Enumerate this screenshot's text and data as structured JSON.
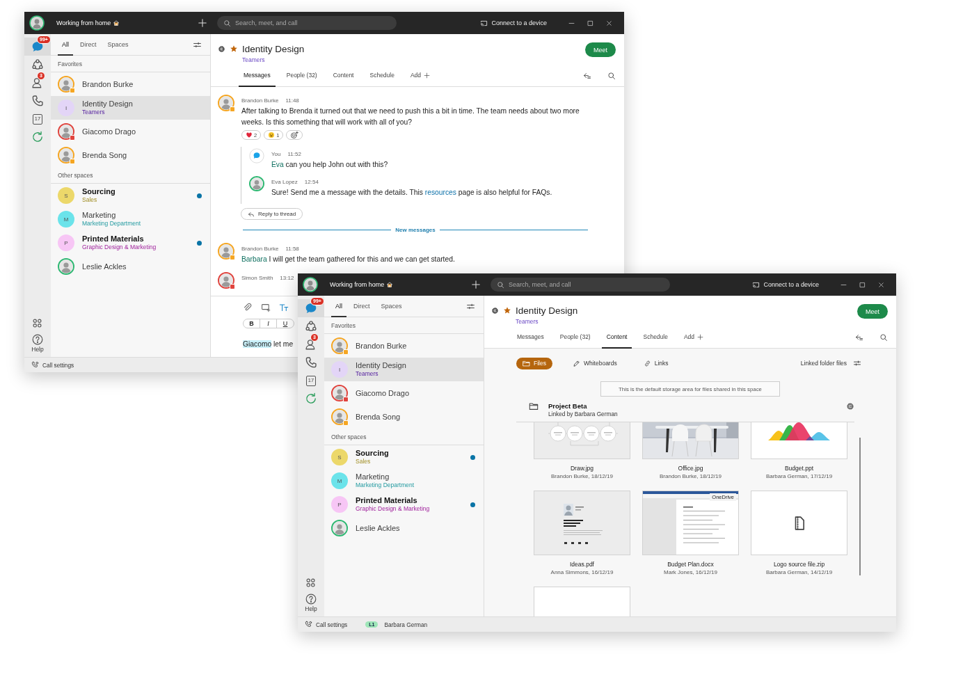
{
  "windows": [
    {
      "kind": "messages",
      "title_bar": {
        "status": "Working from home",
        "search_placeholder": "Search, meet, and call",
        "connect": "Connect to a device"
      },
      "rail": {
        "items": [
          {
            "kind": "chat",
            "badge": "99+",
            "selected": true
          },
          {
            "kind": "teams",
            "selected": false
          },
          {
            "kind": "contacts",
            "badge": "3",
            "selected": false
          },
          {
            "kind": "calls",
            "selected": false
          },
          {
            "kind": "calendar",
            "label": "17",
            "selected": false
          },
          {
            "kind": "refresh",
            "selected": false
          }
        ],
        "help": "Help"
      },
      "sidebar": {
        "filters": [
          {
            "label": "All",
            "selected": true
          },
          {
            "label": "Direct",
            "selected": false
          },
          {
            "label": "Spaces",
            "selected": false
          }
        ],
        "sections": [
          {
            "title": "Favorites",
            "items": [
              {
                "kind": "person",
                "name": "Brandon Burke",
                "color": "#f5a623",
                "presence": true,
                "selected": false,
                "unread": false
              },
              {
                "kind": "space",
                "initial": "I",
                "name": "Identity Design",
                "subtitle": "Teamers",
                "color": "#e3d5f7",
                "selected": true,
                "unread": false
              },
              {
                "kind": "person",
                "name": "Giacomo Drago",
                "color": "#e0443e",
                "presence": true,
                "selected": false,
                "unread": false
              },
              {
                "kind": "person",
                "name": "Brenda Song",
                "color": "#f5a623",
                "presence": true,
                "selected": false,
                "unread": false
              }
            ]
          },
          {
            "title": "Other spaces",
            "items": [
              {
                "kind": "space",
                "initial": "S",
                "name": "Sourcing",
                "subtitle": "Sales",
                "color": "#ecd86a",
                "selected": false,
                "unread": true
              },
              {
                "kind": "space",
                "initial": "M",
                "name": "Marketing",
                "subtitle": "Marketing Department",
                "color": "#6be3ea",
                "selected": false,
                "unread": false
              },
              {
                "kind": "space",
                "initial": "P",
                "name": "Printed Materials",
                "subtitle": "Graphic Design & Marketing",
                "color": "#f7c6f5",
                "selected": false,
                "unread": true
              },
              {
                "kind": "person",
                "name": "Leslie Ackles",
                "color": "#2eb872",
                "presence": false,
                "selected": false,
                "unread": false
              }
            ]
          }
        ]
      },
      "space": {
        "name": "Identity Design",
        "team": "Teamers",
        "favorite": true,
        "meet": "Meet",
        "tabs": [
          {
            "label": "Messages",
            "selected": true
          },
          {
            "label": "People (32)",
            "selected": false
          },
          {
            "label": "Content",
            "selected": false
          },
          {
            "label": "Schedule",
            "selected": false
          },
          {
            "label": "Add",
            "selected": false
          }
        ]
      },
      "messages": [
        {
          "kind": "message",
          "author": "Brandon Burke",
          "time": "11:48",
          "avatar": {
            "kind": "person",
            "color": "#f5a623",
            "presence": true
          },
          "parts": [
            {
              "text": "After talking to Brenda it turned out that we need to push this a bit in time. The team needs about two more weeks. Is this something that will work with all of you?"
            }
          ],
          "reactions": [
            {
              "kind": "heart",
              "count": "2"
            },
            {
              "kind": "smile",
              "count": "1"
            },
            {
              "kind": "add"
            }
          ],
          "thread": {
            "replies": [
              {
                "author": "You",
                "time": "11:52",
                "avatar": {
                  "kind": "self",
                  "color": "#1aa3e8"
                },
                "parts": [
                  {
                    "kind": "mention",
                    "text": "Eva"
                  },
                  {
                    "text": " can you help John out with this?"
                  }
                ]
              },
              {
                "author": "Eva Lopez",
                "time": "12:54",
                "avatar": {
                  "kind": "person",
                  "color": "#2eb872",
                  "presence": false
                },
                "parts": [
                  {
                    "text": "Sure! Send me a message with the details. This "
                  },
                  {
                    "kind": "link",
                    "text": "resources"
                  },
                  {
                    "text": " page is also helpful for FAQs."
                  }
                ]
              }
            ],
            "reply_button": "Reply to thread"
          }
        },
        {
          "kind": "divider",
          "label": "New messages"
        },
        {
          "kind": "message",
          "author": "Brandon Burke",
          "time": "11:58",
          "avatar": {
            "kind": "person",
            "color": "#f5a623",
            "presence": true
          },
          "parts": [
            {
              "kind": "mention",
              "text": "Barbara"
            },
            {
              "text": " I will get the team gathered for this and we can get started."
            }
          ]
        },
        {
          "kind": "message",
          "author": "Simon Smith",
          "time": "13:12",
          "avatar": {
            "kind": "person",
            "color": "#e0443e",
            "presence": true
          }
        }
      ],
      "composer": {
        "tools": [
          {
            "kind": "attach",
            "active": false
          },
          {
            "kind": "screen",
            "active": false
          },
          {
            "kind": "format",
            "active": true
          }
        ],
        "format_buttons": [
          {
            "kind": "bold",
            "label": "B"
          },
          {
            "kind": "italic",
            "label": "I"
          },
          {
            "kind": "underline",
            "label": "U"
          }
        ],
        "parts": [
          {
            "kind": "mention",
            "text": "Giacomo"
          },
          {
            "text": " let me"
          }
        ]
      },
      "status_bar": {
        "call_settings": "Call settings"
      }
    },
    {
      "kind": "content",
      "title_bar": {
        "status": "Working from home",
        "search_placeholder": "Search, meet, and call",
        "connect": "Connect to a device"
      },
      "rail": {
        "items": [
          {
            "kind": "chat",
            "badge": "99+",
            "selected": true
          },
          {
            "kind": "teams",
            "selected": false
          },
          {
            "kind": "contacts",
            "badge": "3",
            "selected": false
          },
          {
            "kind": "calls",
            "selected": false
          },
          {
            "kind": "calendar",
            "label": "17",
            "selected": false
          },
          {
            "kind": "refresh",
            "selected": false
          }
        ],
        "help": "Help"
      },
      "sidebar": {
        "filters": [
          {
            "label": "All",
            "selected": true
          },
          {
            "label": "Direct",
            "selected": false
          },
          {
            "label": "Spaces",
            "selected": false
          }
        ],
        "sections": [
          {
            "title": "Favorites",
            "items": [
              {
                "kind": "person",
                "name": "Brandon Burke",
                "color": "#f5a623",
                "presence": true,
                "selected": false,
                "unread": false
              },
              {
                "kind": "space",
                "initial": "I",
                "name": "Identity Design",
                "subtitle": "Teamers",
                "color": "#e3d5f7",
                "selected": true,
                "unread": false
              },
              {
                "kind": "person",
                "name": "Giacomo Drago",
                "color": "#e0443e",
                "presence": true,
                "selected": false,
                "unread": false
              },
              {
                "kind": "person",
                "name": "Brenda Song",
                "color": "#f5a623",
                "presence": true,
                "selected": false,
                "unread": false
              }
            ]
          },
          {
            "title": "Other spaces",
            "items": [
              {
                "kind": "space",
                "initial": "S",
                "name": "Sourcing",
                "subtitle": "Sales",
                "color": "#ecd86a",
                "selected": false,
                "unread": true
              },
              {
                "kind": "space",
                "initial": "M",
                "name": "Marketing",
                "subtitle": "Marketing Department",
                "color": "#6be3ea",
                "selected": false,
                "unread": false
              },
              {
                "kind": "space",
                "initial": "P",
                "name": "Printed Materials",
                "subtitle": "Graphic Design & Marketing",
                "color": "#f7c6f5",
                "selected": false,
                "unread": true
              },
              {
                "kind": "person",
                "name": "Leslie Ackles",
                "color": "#2eb872",
                "presence": false,
                "selected": false,
                "unread": false
              }
            ]
          }
        ]
      },
      "space": {
        "name": "Identity Design",
        "team": "Teamers",
        "favorite": true,
        "meet": "Meet",
        "tabs": [
          {
            "label": "Messages",
            "selected": false
          },
          {
            "label": "People (32)",
            "selected": false
          },
          {
            "label": "Content",
            "selected": true
          },
          {
            "label": "Schedule",
            "selected": false
          },
          {
            "label": "Add",
            "selected": false
          }
        ]
      },
      "content": {
        "filters": [
          {
            "kind": "files",
            "label": "Files",
            "selected": true
          },
          {
            "kind": "whiteboards",
            "label": "Whiteboards",
            "selected": false
          },
          {
            "kind": "links",
            "label": "Links",
            "selected": false
          }
        ],
        "linked": "Linked folder files",
        "notice": "This is the default storage area for files shared in this space",
        "folder": {
          "name": "Project Beta",
          "subtitle": "Linked by Barbara German"
        },
        "files": [
          {
            "kind": "diagram",
            "name": "Draw.jpg",
            "meta": "Brandon Burke, 18/12/19"
          },
          {
            "kind": "picture",
            "name": "Office.jpg",
            "meta": "Brandon Burke, 18/12/19"
          },
          {
            "kind": "chart",
            "name": "Budget.ppt",
            "meta": "Barbara German, 17/12/19"
          },
          {
            "kind": "document",
            "name": "Ideas.pdf",
            "meta": "Anna Simmons, 16/12/19"
          },
          {
            "kind": "web-document",
            "name": "Budget Plan.docx",
            "meta": "Mark Jones, 16/12/19",
            "badge": "OneDrive"
          },
          {
            "kind": "file",
            "name": "Logo source file.zip",
            "meta": "Barbara German, 14/12/19"
          },
          {
            "kind": "blank"
          }
        ]
      },
      "status_bar": {
        "call_settings": "Call settings",
        "user_badge": "L1",
        "user": "Barbara German"
      }
    }
  ]
}
